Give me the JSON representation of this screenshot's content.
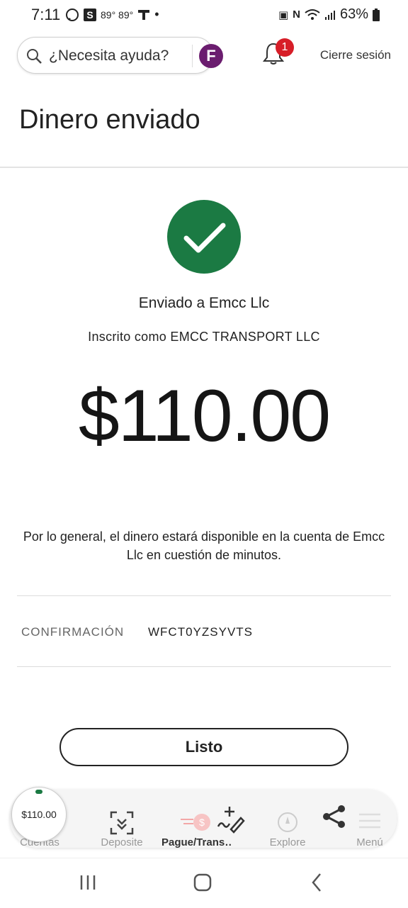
{
  "status_bar": {
    "time": "7:11",
    "weather": "89° 89°",
    "battery": "63%"
  },
  "header": {
    "search_placeholder": "¿Necesita ayuda?",
    "notification_count": "1",
    "logout_label": "Cierre sesión"
  },
  "page": {
    "title": "Dinero enviado",
    "sent_to": "Enviado a Emcc Llc",
    "enrolled_as": "Inscrito como EMCC TRANSPORT LLC",
    "amount": "$110.00",
    "note": "Por lo general, el dinero estará disponible en la cuenta de Emcc Llc en cuestión de minutos.",
    "confirmation_label": "CONFIRMACIÓN",
    "confirmation_value": "WFCT0YZSYVTS",
    "done_label": "Listo"
  },
  "bottom_nav": {
    "amount_bubble": "$110.00",
    "items": [
      {
        "label": "Cuentas",
        "icon": "accounts-icon"
      },
      {
        "label": "Deposite",
        "icon": "deposit-scan-icon"
      },
      {
        "label": "Pague/Trans…",
        "icon": "pay-transfer-icon"
      },
      {
        "label": "Explore",
        "icon": "explore-icon"
      },
      {
        "label": "Menú",
        "icon": "menu-icon"
      }
    ]
  },
  "colors": {
    "success_green": "#1b7a43",
    "badge_red": "#d71e28",
    "brand_purple": "#6b1d6f"
  }
}
